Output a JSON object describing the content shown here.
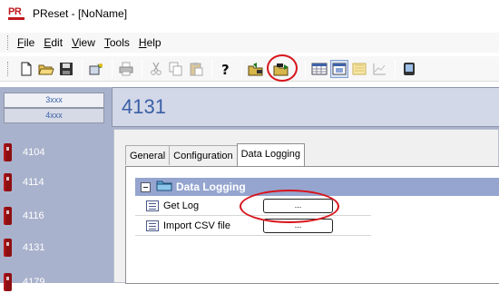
{
  "window": {
    "logo_text": "PR",
    "title": "PReset - [NoName]"
  },
  "menu": [
    {
      "label": "File",
      "mnemonic": "F",
      "rest": "ile"
    },
    {
      "label": "Edit",
      "mnemonic": "E",
      "rest": "dit"
    },
    {
      "label": "View",
      "mnemonic": "V",
      "rest": "iew"
    },
    {
      "label": "Tools",
      "mnemonic": "T",
      "rest": "ools"
    },
    {
      "label": "Help",
      "mnemonic": "H",
      "rest": "elp"
    }
  ],
  "toolbar": {
    "icons": [
      "new-file-icon",
      "open-folder-icon",
      "save-icon",
      "wizard-icon",
      "print-icon",
      "cut-icon",
      "copy-icon",
      "paste-icon",
      "help-icon",
      "read-from-device-icon",
      "write-to-device-icon",
      "grid-view-icon",
      "form-view-icon",
      "chart-view-icon",
      "line-graph-icon",
      "monitor-icon"
    ],
    "highlighted": "write-to-device-icon",
    "highlight_color": "#d8141b"
  },
  "left_panel": {
    "family_tabs": [
      "3xxx",
      "4xxx"
    ],
    "active_family": "4xxx",
    "devices": [
      "4104",
      "4114",
      "4116",
      "4131",
      "4179"
    ]
  },
  "main": {
    "device_number": "4131",
    "tabs": [
      "General",
      "Configuration",
      "Data Logging"
    ],
    "selected_tab": "Data Logging",
    "section": {
      "title": "Data Logging",
      "rows": [
        {
          "label": "Get Log",
          "button": "..."
        },
        {
          "label": "Import CSV file",
          "button": "..."
        }
      ]
    }
  },
  "colors": {
    "panel_bg": "#a9b2cc",
    "section_header": "#95a5cf",
    "accent_text": "#3a5fa6",
    "annotation_red": "#d8141b"
  }
}
